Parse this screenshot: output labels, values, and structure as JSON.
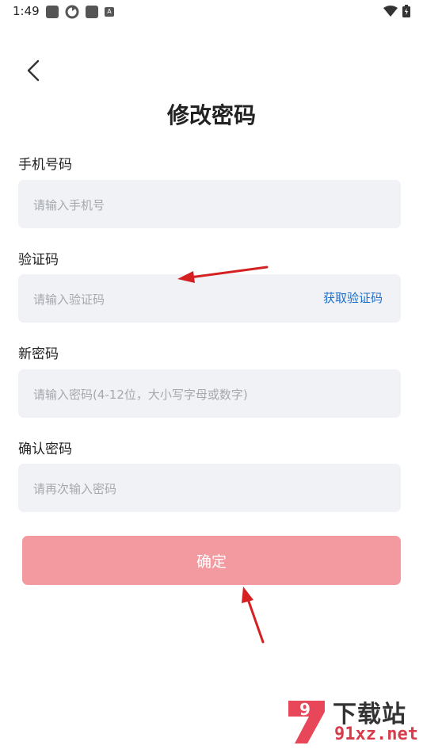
{
  "status_bar": {
    "time": "1:49",
    "notification_icons": [
      "app-icon",
      "sync-icon",
      "app-icon",
      "a-icon"
    ],
    "system_icons": [
      "wifi-icon",
      "battery-icon"
    ]
  },
  "header": {
    "back_icon": "chevron-left-icon",
    "title": "修改密码"
  },
  "form": {
    "phone": {
      "label": "手机号码",
      "placeholder": "请输入手机号"
    },
    "code": {
      "label": "验证码",
      "placeholder": "请输入验证码",
      "action": "获取验证码"
    },
    "new_password": {
      "label": "新密码",
      "placeholder": "请输入密码(4-12位，大小写字母或数字)"
    },
    "confirm_password": {
      "label": "确认密码",
      "placeholder": "请再次输入密码"
    },
    "submit_label": "确定"
  },
  "colors": {
    "primary": "#f39aa0",
    "link": "#1e6fcc",
    "field_bg": "#f0f2f5",
    "annotation_arrow": "#d42020"
  },
  "watermark": {
    "logo_text": "9",
    "name_cn": "下载站",
    "name_en": "91xz.net"
  }
}
